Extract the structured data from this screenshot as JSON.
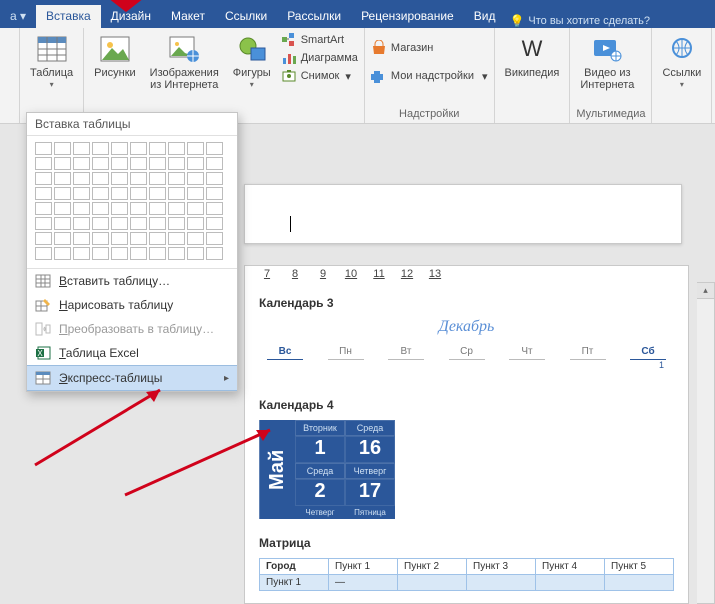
{
  "tabs": {
    "file_fragment": "а ▾",
    "insert": "Вставка",
    "design": "Дизайн",
    "layout": "Макет",
    "references": "Ссылки",
    "mailings": "Рассылки",
    "review": "Рецензирование",
    "view": "Вид",
    "tellme_icon": "💡",
    "tellme": "Что вы хотите сделать?"
  },
  "ribbon": {
    "tables": {
      "table_btn": "Таблица",
      "group_label": ""
    },
    "illustrations": {
      "pictures": "Рисунки",
      "online_pics_l1": "Изображения",
      "online_pics_l2": "из Интернета",
      "shapes": "Фигуры",
      "smartart": "SmartArt",
      "chart": "Диаграмма",
      "screenshot": "Снимок",
      "group_label": ""
    },
    "addins": {
      "store": "Магазин",
      "myaddins": "Мои надстройки",
      "group_label": "Надстройки"
    },
    "media": {
      "wikipedia": "Википедия",
      "video_l1": "Видео из",
      "video_l2": "Интернета",
      "group_label": "Мультимедиа"
    },
    "links": {
      "links_btn": "Ссылки",
      "group_label": ""
    }
  },
  "tblpanel": {
    "header": "Вставка таблицы",
    "insert_u": "В",
    "insert_rest": "ставить таблицу…",
    "draw_u": "Н",
    "draw_rest": "арисовать таблицу",
    "convert_u": "П",
    "convert_rest": "реобразовать в таблицу…",
    "excel_u": "Т",
    "excel_rest": "аблица Excel",
    "quick_u": "Э",
    "quick_rest": "кспресс-таблицы"
  },
  "ruler": {
    "t7": "7",
    "t8": "8",
    "t9": "9",
    "t10": "10",
    "t11": "11",
    "t12": "12",
    "t13": "13"
  },
  "gallery": {
    "cal3_title": "Календарь 3",
    "cal3_month": "Декабрь",
    "cal3_days": {
      "su": "Вс",
      "mo": "Пн",
      "tu": "Вт",
      "we": "Ср",
      "th": "Чт",
      "fr": "Пт",
      "sa": "Сб"
    },
    "cal3_sat_num": "1",
    "cal4_title": "Календарь 4",
    "cal4_month": "Май",
    "cal4": {
      "h1": "Вторник",
      "h2": "Среда",
      "n1": "1",
      "n2": "16",
      "h3": "Среда",
      "h4": "Четверг",
      "n3": "2",
      "n4": "17",
      "f1": "Четверг",
      "f2": "Пятница"
    },
    "matrix_title": "Матрица",
    "matrix": {
      "h0": "Город",
      "h1": "Пункт 1",
      "h2": "Пункт 2",
      "h3": "Пункт 3",
      "h4": "Пункт 4",
      "h5": "Пункт 5",
      "r1c0": "Пункт 1",
      "r1c1": "—"
    }
  }
}
